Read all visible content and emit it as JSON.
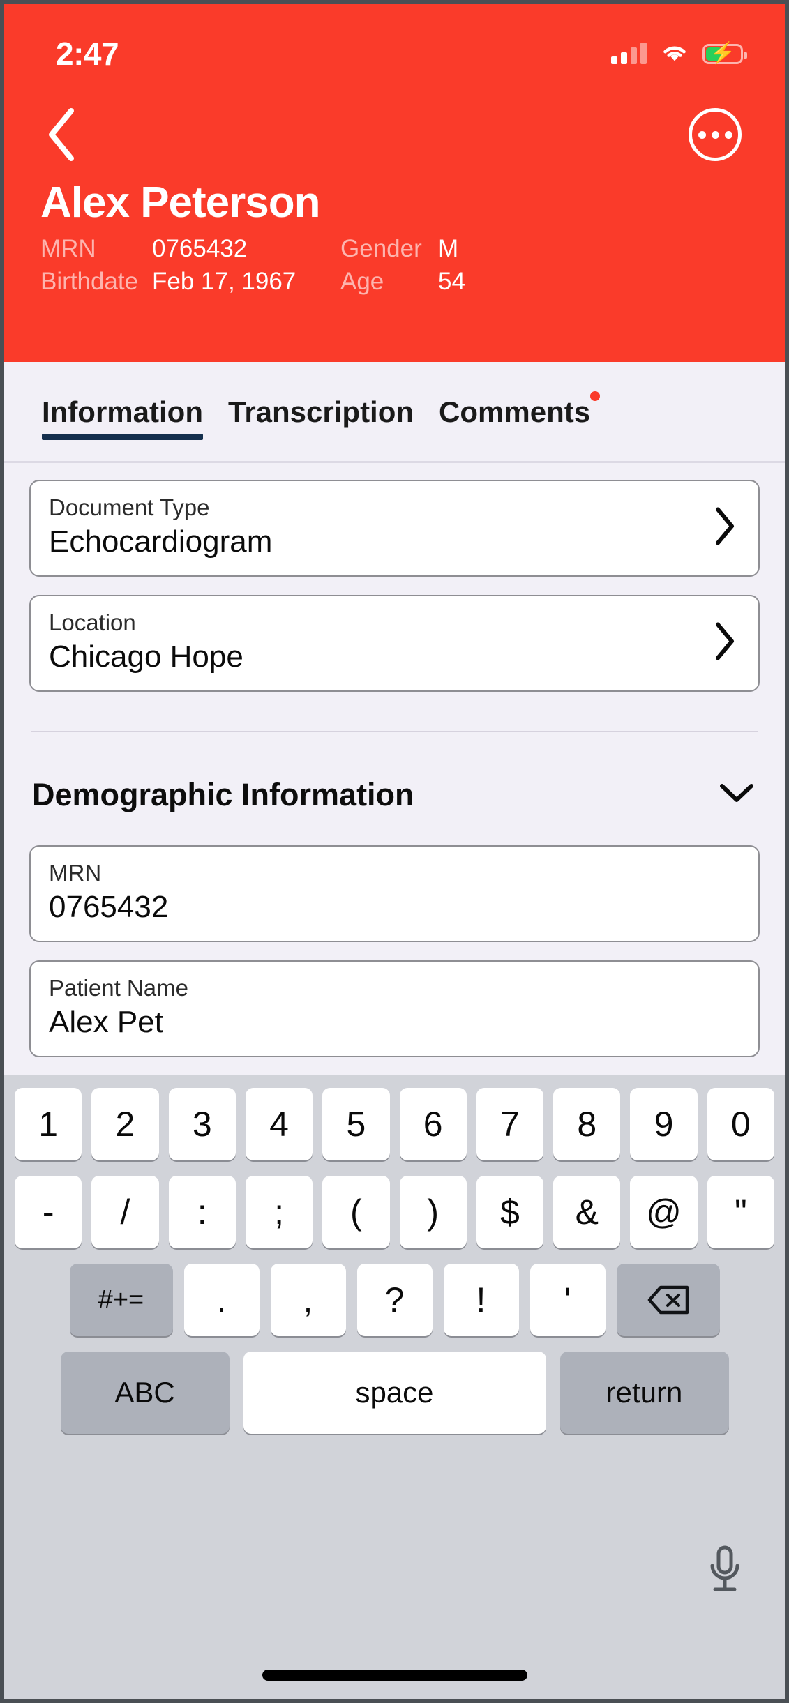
{
  "status_bar": {
    "time": "2:47",
    "signal_icon": "cellular-signal-icon",
    "wifi_icon": "wifi-icon",
    "battery_icon": "battery-charging-icon",
    "battery_color": "#29d05a"
  },
  "header": {
    "background_color": "#fa3b2a",
    "back_icon": "chevron-left-icon",
    "more_icon": "ellipsis-circle-icon",
    "patient_name": "Alex Peterson",
    "fields": [
      {
        "label": "MRN",
        "value": "0765432"
      },
      {
        "label": "Gender",
        "value": "M"
      },
      {
        "label": "Birthdate",
        "value": "Feb 17, 1967"
      },
      {
        "label": "Age",
        "value": "54"
      }
    ]
  },
  "tabs": {
    "active_index": 0,
    "active_underline_color": "#15304e",
    "badge_color": "#fa3b2a",
    "items": [
      {
        "label": "Information",
        "active": true,
        "badge": false
      },
      {
        "label": "Transcription",
        "active": false,
        "badge": false
      },
      {
        "label": "Comments",
        "active": false,
        "badge": true
      }
    ]
  },
  "content": {
    "document_fields": [
      {
        "label": "Document Type",
        "value": "Echocardiogram",
        "chevron": "chevron-right-icon"
      },
      {
        "label": "Location",
        "value": "Chicago Hope",
        "chevron": "chevron-right-icon"
      }
    ],
    "section": {
      "title": "Demographic Information",
      "collapse_icon": "chevron-down-icon"
    },
    "demographic_fields": [
      {
        "label": "MRN",
        "value": "0765432"
      },
      {
        "label": "Patient Name",
        "value": "Alex Pet"
      }
    ]
  },
  "keyboard": {
    "background_color": "#d1d3d9",
    "row1": [
      "1",
      "2",
      "3",
      "4",
      "5",
      "6",
      "7",
      "8",
      "9",
      "0"
    ],
    "row2": [
      "-",
      "/",
      ":",
      ";",
      "(",
      ")",
      "$",
      "&",
      "@",
      "\""
    ],
    "row3_left": "#+=",
    "row3": [
      ".",
      ",",
      "?",
      "!",
      "'"
    ],
    "row3_right_icon": "backspace-icon",
    "row4": {
      "letters_label": "ABC",
      "space_label": "space",
      "return_label": "return"
    },
    "dictation_icon": "microphone-icon",
    "home_indicator": "home-indicator"
  }
}
